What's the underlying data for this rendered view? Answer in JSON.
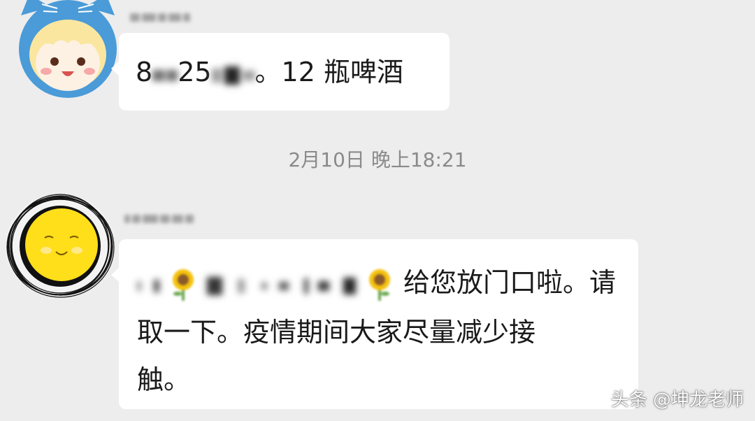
{
  "messages": [
    {
      "sender_avatar": "cat-hood-girl-avatar",
      "text_visible_prefix": "8",
      "text_visible_middle": "25",
      "text_visible_suffix": "。12 瓶啤酒"
    },
    {
      "sender_avatar": "sun-face-avatar",
      "text_line1": "给您放门口啦。请",
      "text_line2": "取一下。疫情期间大家尽量减少接",
      "text_line3": "触。"
    }
  ],
  "timestamp": "2月10日 晚上18:21",
  "watermark": "头条 @坤龙老师",
  "colors": {
    "background": "#ededed",
    "bubble": "#ffffff",
    "text": "#1a1a1a",
    "timestamp": "#8a8a8a"
  },
  "icons": [
    "cat-hood-girl-avatar",
    "sun-face-avatar",
    "sunflower-icon"
  ]
}
